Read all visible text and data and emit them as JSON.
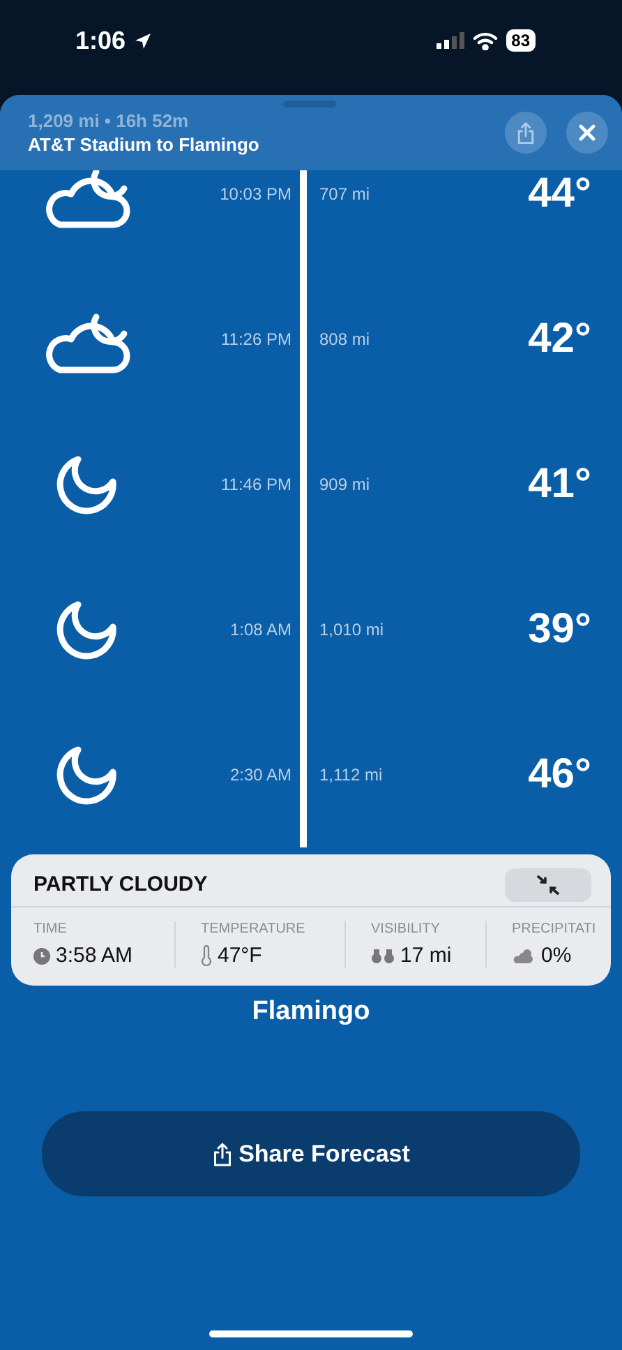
{
  "status_bar": {
    "time": "1:06",
    "battery": "83"
  },
  "sheet": {
    "summary": "1,209 mi • 16h 52m",
    "route": "AT&T Stadium to Flamingo"
  },
  "timeline": [
    {
      "kind": "partly-cloudy-night",
      "time": "10:03 PM",
      "distance": "707 mi",
      "temperature": "44°"
    },
    {
      "kind": "partly-cloudy-night",
      "time": "11:26 PM",
      "distance": "808 mi",
      "temperature": "42°"
    },
    {
      "kind": "clear-night",
      "time": "11:46 PM",
      "distance": "909 mi",
      "temperature": "41°"
    },
    {
      "kind": "clear-night",
      "time": "1:08 AM",
      "distance": "1,010 mi",
      "temperature": "39°"
    },
    {
      "kind": "clear-night",
      "time": "2:30 AM",
      "distance": "1,112 mi",
      "temperature": "46°"
    }
  ],
  "detail_card": {
    "title": "PARTLY CLOUDY",
    "stats": [
      {
        "kind": "time",
        "label": "TIME",
        "value": "3:58 AM"
      },
      {
        "kind": "temperature",
        "label": "TEMPERATURE",
        "value": "47°F"
      },
      {
        "kind": "visibility",
        "label": "VISIBILITY",
        "value": "17 mi"
      },
      {
        "kind": "precipitation",
        "label": "PRECIPITATI",
        "value": "0%"
      }
    ]
  },
  "destination": "Flamingo",
  "share_button": "Share Forecast"
}
